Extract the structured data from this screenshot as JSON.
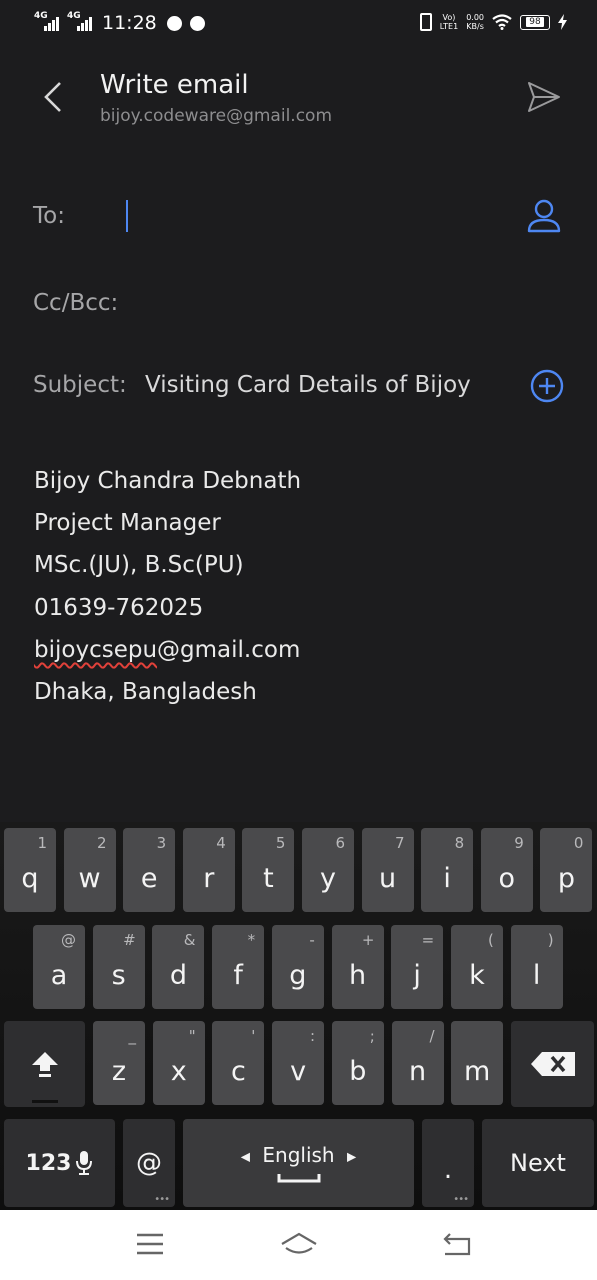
{
  "status_bar": {
    "sim1": "4G",
    "sim2": "4G",
    "time": "11:28",
    "network_label_top": "Vo)",
    "network_label_bottom": "LTE1",
    "speed_value": "0.00",
    "speed_unit": "KB/s",
    "battery": "98"
  },
  "header": {
    "title": "Write email",
    "account": "bijoy.codeware@gmail.com"
  },
  "form": {
    "to_label": "To:",
    "to_value": "",
    "cc_label": "Cc/Bcc:",
    "subject_label": "Subject:",
    "subject_value": "Visiting Card Details of Bijoy"
  },
  "body": {
    "lines": [
      "Bijoy Chandra Debnath",
      "Project Manager",
      "MSc.(JU), B.Sc(PU)",
      "01639-762025",
      "bijoycsepu",
      "@gmail.com",
      "Dhaka, Bangladesh"
    ]
  },
  "keyboard": {
    "row1": [
      {
        "ch": "q",
        "sup": "1"
      },
      {
        "ch": "w",
        "sup": "2"
      },
      {
        "ch": "e",
        "sup": "3"
      },
      {
        "ch": "r",
        "sup": "4"
      },
      {
        "ch": "t",
        "sup": "5"
      },
      {
        "ch": "y",
        "sup": "6"
      },
      {
        "ch": "u",
        "sup": "7"
      },
      {
        "ch": "i",
        "sup": "8"
      },
      {
        "ch": "o",
        "sup": "9"
      },
      {
        "ch": "p",
        "sup": "0"
      }
    ],
    "row2": [
      {
        "ch": "a",
        "sup": "@"
      },
      {
        "ch": "s",
        "sup": "#"
      },
      {
        "ch": "d",
        "sup": "&"
      },
      {
        "ch": "f",
        "sup": "*"
      },
      {
        "ch": "g",
        "sup": "-"
      },
      {
        "ch": "h",
        "sup": "+"
      },
      {
        "ch": "j",
        "sup": "="
      },
      {
        "ch": "k",
        "sup": "("
      },
      {
        "ch": "l",
        "sup": ")"
      }
    ],
    "row3": [
      {
        "ch": "z",
        "sup": "_"
      },
      {
        "ch": "x",
        "sup": "\""
      },
      {
        "ch": "c",
        "sup": "'"
      },
      {
        "ch": "v",
        "sup": ":"
      },
      {
        "ch": "b",
        "sup": ";"
      },
      {
        "ch": "n",
        "sup": "/"
      },
      {
        "ch": "m",
        "sup": ""
      }
    ],
    "numbers_key": "123",
    "at_key": "@",
    "language": "English",
    "period_key": ".",
    "action_key": "Next",
    "icons": {
      "shift": "shift-icon",
      "backspace": "backspace-icon",
      "mic": "mic-icon"
    }
  },
  "colors": {
    "background": "#1c1c1e",
    "accent": "#4e87f2",
    "spellcheck": "#e0413a",
    "key": "#4a4a4c"
  }
}
